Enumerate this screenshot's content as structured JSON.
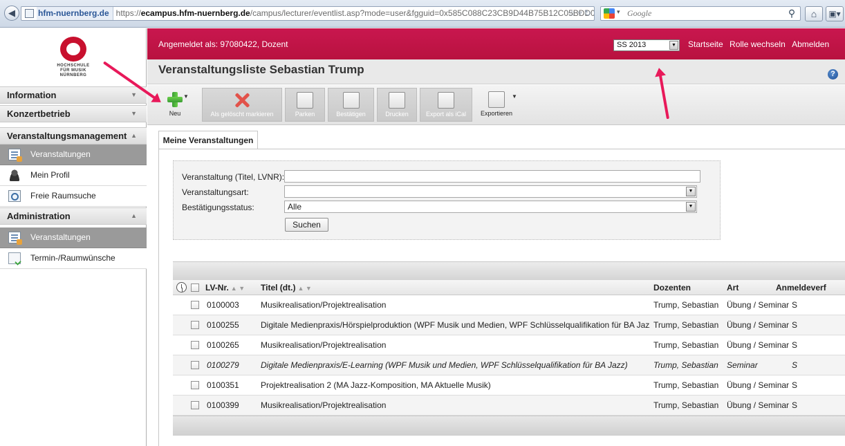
{
  "browser": {
    "domain": "hfm-nuernberg.de",
    "url_prefix": "https://",
    "url_host": "ecampus.hfm-nuernberg.de",
    "url_path": "/campus/lecturer/eventlist.asp?mode=user&fgguid=0x585C088C23CB9D44B75B12C05BDD0",
    "search_placeholder": "Google"
  },
  "logo": {
    "line1": "HOCHSCHULE",
    "line2": "FÜR MUSIK",
    "line3": "NÜRNBERG"
  },
  "sidebar": {
    "sections": [
      {
        "label": "Information",
        "caret": "▼"
      },
      {
        "label": "Konzertbetrieb",
        "caret": "▼"
      },
      {
        "label": "Veranstaltungsmanagement",
        "caret": "▲"
      },
      {
        "label": "Administration",
        "caret": "▲"
      }
    ],
    "items": [
      {
        "label": "Veranstaltungen",
        "icon": "event-list-icon",
        "active": true
      },
      {
        "label": "Mein Profil",
        "icon": "user-icon",
        "active": false
      },
      {
        "label": "Freie Raumsuche",
        "icon": "room-search-icon",
        "active": false
      },
      {
        "label": "Veranstaltungen",
        "icon": "event-list-icon",
        "active": true
      },
      {
        "label": "Termin-/Raumwünsche",
        "icon": "document-check-icon",
        "active": false
      }
    ]
  },
  "header": {
    "logged_in": "Angemeldet als: 97080422, Dozent",
    "semester": "SS 2013",
    "links": [
      "Startseite",
      "Rolle wechseln",
      "Abmelden"
    ],
    "title": "Veranstaltungsliste Sebastian Trump"
  },
  "toolbar": {
    "new_label": "Neu",
    "delete_label": "Als gelöscht markieren",
    "park_label": "Parken",
    "confirm_label": "Bestätigen",
    "print_label": "Drucken",
    "ical_label": "Export als iCal",
    "export_label": "Exportieren"
  },
  "tabs": [
    "Meine Veranstaltungen"
  ],
  "filter": {
    "title_label": "Veranstaltung (Titel, LVNR):",
    "title_value": "",
    "type_label": "Veranstaltungsart:",
    "type_value": "",
    "status_label": "Bestätigungsstatus:",
    "status_value": "Alle",
    "search_button": "Suchen"
  },
  "table": {
    "columns": {
      "lvnr": "LV-Nr.",
      "title": "Titel (dt.)",
      "lecturers": "Dozenten",
      "type": "Art",
      "registration": "Anmeldeverf"
    },
    "sort_lvnr": "▲ ▼",
    "sort_title": "▲ ▼",
    "rows": [
      {
        "lvnr": "0100003",
        "title": "Musikrealisation/Projektrealisation",
        "lecturers": "Trump, Sebastian",
        "type": "Übung / Seminar",
        "registration": "S"
      },
      {
        "lvnr": "0100255",
        "title": "Digitale Medienpraxis/Hörspielproduktion (WPF Musik und Medien, WPF Schlüsselqualifikation für BA Jazz)",
        "lecturers": "Trump, Sebastian",
        "type": "Übung / Seminar",
        "registration": "S"
      },
      {
        "lvnr": "0100265",
        "title": "Musikrealisation/Projektrealisation",
        "lecturers": "Trump, Sebastian",
        "type": "Übung / Seminar",
        "registration": "S"
      },
      {
        "lvnr": "0100279",
        "title": "Digitale Medienpraxis/E-Learning (WPF Musik und Medien, WPF Schlüsselqualifikation für BA Jazz)",
        "lecturers": "Trump, Sebastian",
        "type": "Seminar",
        "registration": "S"
      },
      {
        "lvnr": "0100351",
        "title": "Projektrealisation 2 (MA Jazz-Komposition, MA Aktuelle Musik)",
        "lecturers": "Trump, Sebastian",
        "type": "Übung / Seminar",
        "registration": "S"
      },
      {
        "lvnr": "0100399",
        "title": "Musikrealisation/Projektrealisation",
        "lecturers": "Trump, Sebastian",
        "type": "Übung / Seminar",
        "registration": "S"
      }
    ]
  },
  "colors": {
    "brand": "#c4154b",
    "annotation": "#e8195a",
    "nav_active": "#9a9a9a"
  }
}
